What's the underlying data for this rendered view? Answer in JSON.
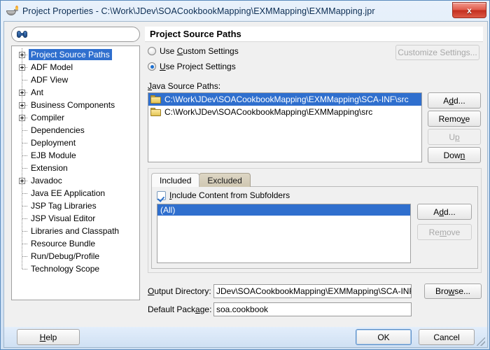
{
  "window": {
    "title": "Project Properties - C:\\Work\\JDev\\SOACookbookMapping\\EXMMapping\\EXMMapping.jpr",
    "icon": "jdeveloper-lamp-icon",
    "close_label": "x"
  },
  "sidebar": {
    "search": {
      "value": "",
      "placeholder": "",
      "icon": "binoculars-icon"
    },
    "items": [
      {
        "label": "Project Source Paths",
        "expandable": true,
        "selected": true
      },
      {
        "label": "ADF Model",
        "expandable": true,
        "selected": false
      },
      {
        "label": "ADF View",
        "expandable": false,
        "selected": false
      },
      {
        "label": "Ant",
        "expandable": true,
        "selected": false
      },
      {
        "label": "Business Components",
        "expandable": true,
        "selected": false
      },
      {
        "label": "Compiler",
        "expandable": true,
        "selected": false
      },
      {
        "label": "Dependencies",
        "expandable": false,
        "selected": false
      },
      {
        "label": "Deployment",
        "expandable": false,
        "selected": false
      },
      {
        "label": "EJB Module",
        "expandable": false,
        "selected": false
      },
      {
        "label": "Extension",
        "expandable": false,
        "selected": false
      },
      {
        "label": "Javadoc",
        "expandable": true,
        "selected": false
      },
      {
        "label": "Java EE Application",
        "expandable": false,
        "selected": false
      },
      {
        "label": "JSP Tag Libraries",
        "expandable": false,
        "selected": false
      },
      {
        "label": "JSP Visual Editor",
        "expandable": false,
        "selected": false
      },
      {
        "label": "Libraries and Classpath",
        "expandable": false,
        "selected": false
      },
      {
        "label": "Resource Bundle",
        "expandable": false,
        "selected": false
      },
      {
        "label": "Run/Debug/Profile",
        "expandable": false,
        "selected": false
      },
      {
        "label": "Technology Scope",
        "expandable": false,
        "selected": false
      }
    ]
  },
  "main": {
    "title": "Project Source Paths",
    "settings_mode": {
      "custom": {
        "label": "Use Custom Settings",
        "mnemonic": "C",
        "selected": false
      },
      "project": {
        "label": "Use Project Settings",
        "mnemonic": "U",
        "selected": true
      },
      "customize_button": {
        "label": "Customize Settings...",
        "enabled": false
      }
    },
    "java_source_paths": {
      "label": "Java Source Paths:",
      "entries": [
        {
          "path": "C:\\Work\\JDev\\SOACookbookMapping\\EXMMapping\\SCA-INF\\src",
          "selected": true,
          "icon": "folder-icon"
        },
        {
          "path": "C:\\Work\\JDev\\SOACookbookMapping\\EXMMapping\\src",
          "selected": false,
          "icon": "folder-icon"
        }
      ],
      "buttons": [
        {
          "label": "Add...",
          "enabled": true
        },
        {
          "label": "Remove",
          "enabled": true
        },
        {
          "label": "Up",
          "enabled": false
        },
        {
          "label": "Down",
          "enabled": true
        }
      ]
    },
    "filter": {
      "tabs": [
        {
          "label": "Included",
          "active": true
        },
        {
          "label": "Excluded",
          "active": false
        }
      ],
      "include_subfolders": {
        "label": "Include Content from Subfolders",
        "checked": true
      },
      "entries": [
        {
          "label": "(All)",
          "selected": true
        }
      ],
      "buttons": [
        {
          "label": "Add...",
          "enabled": true
        },
        {
          "label": "Remove",
          "enabled": false
        }
      ]
    },
    "output_directory": {
      "label": "Output Directory:",
      "value": "JDev\\SOACookbookMapping\\EXMMapping\\SCA-INF\\classes",
      "browse_label": "Browse..."
    },
    "default_package": {
      "label": "Default Package:",
      "value": "soa.cookbook"
    }
  },
  "footer": {
    "help": "Help",
    "ok": "OK",
    "cancel": "Cancel"
  }
}
